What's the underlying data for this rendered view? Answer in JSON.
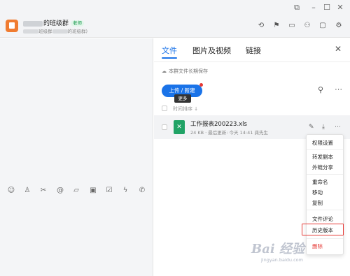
{
  "window_controls": {
    "pin": "⧉",
    "minimize": "–",
    "maximize": "☐",
    "close": "✕"
  },
  "header": {
    "group_name": "的班级群",
    "tag": "老师",
    "subtitle_prefix": "班级群",
    "subtitle_suffix": "的班级群)"
  },
  "panel": {
    "tabs": [
      {
        "label": "文件"
      },
      {
        "label": "图片及视频"
      },
      {
        "label": "链接"
      }
    ],
    "cloud_note": "本群文件长期保存",
    "upload_button": "上传 / 新建",
    "sort_label": "时间排序",
    "file": {
      "name": "工作报表200223.xls",
      "size": "24 KB",
      "updated_label": "最后更新:",
      "updated_time": "今天 14:41",
      "owner": "龚先生"
    },
    "tooltip": "更多"
  },
  "menu": {
    "items": [
      "权限设置",
      "转发副本",
      "外链分享",
      "重命名",
      "移动",
      "复制",
      "文件评论",
      "历史版本",
      "删除"
    ]
  },
  "watermark": {
    "logo": "Bai 经验",
    "url": "jingyan.baidu.com"
  }
}
